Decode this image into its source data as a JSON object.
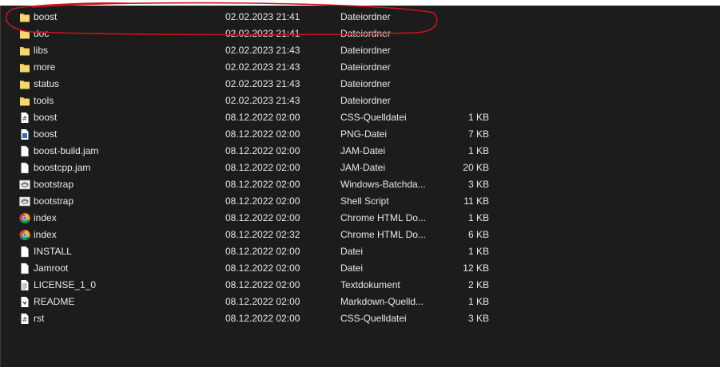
{
  "files": [
    {
      "name": "boost",
      "date": "02.02.2023 21:41",
      "type": "Dateiordner",
      "size": "",
      "icon": "folder-icon"
    },
    {
      "name": "doc",
      "date": "02.02.2023 21:41",
      "type": "Dateiordner",
      "size": "",
      "icon": "folder-icon"
    },
    {
      "name": "libs",
      "date": "02.02.2023 21:43",
      "type": "Dateiordner",
      "size": "",
      "icon": "folder-icon"
    },
    {
      "name": "more",
      "date": "02.02.2023 21:43",
      "type": "Dateiordner",
      "size": "",
      "icon": "folder-icon"
    },
    {
      "name": "status",
      "date": "02.02.2023 21:43",
      "type": "Dateiordner",
      "size": "",
      "icon": "folder-icon"
    },
    {
      "name": "tools",
      "date": "02.02.2023 21:43",
      "type": "Dateiordner",
      "size": "",
      "icon": "folder-icon"
    },
    {
      "name": "boost",
      "date": "08.12.2022 02:00",
      "type": "CSS-Quelldatei",
      "size": "1 KB",
      "icon": "css-file-icon"
    },
    {
      "name": "boost",
      "date": "08.12.2022 02:00",
      "type": "PNG-Datei",
      "size": "7 KB",
      "icon": "png-file-icon"
    },
    {
      "name": "boost-build.jam",
      "date": "08.12.2022 02:00",
      "type": "JAM-Datei",
      "size": "1 KB",
      "icon": "file-icon"
    },
    {
      "name": "boostcpp.jam",
      "date": "08.12.2022 02:00",
      "type": "JAM-Datei",
      "size": "20 KB",
      "icon": "file-icon"
    },
    {
      "name": "bootstrap",
      "date": "08.12.2022 02:00",
      "type": "Windows-Batchda...",
      "size": "3 KB",
      "icon": "batch-file-icon"
    },
    {
      "name": "bootstrap",
      "date": "08.12.2022 02:00",
      "type": "Shell Script",
      "size": "11 KB",
      "icon": "batch-file-icon"
    },
    {
      "name": "index",
      "date": "08.12.2022 02:00",
      "type": "Chrome HTML Do...",
      "size": "1 KB",
      "icon": "chrome-icon"
    },
    {
      "name": "index",
      "date": "08.12.2022 02:32",
      "type": "Chrome HTML Do...",
      "size": "6 KB",
      "icon": "chrome-icon"
    },
    {
      "name": "INSTALL",
      "date": "08.12.2022 02:00",
      "type": "Datei",
      "size": "1 KB",
      "icon": "file-icon"
    },
    {
      "name": "Jamroot",
      "date": "08.12.2022 02:00",
      "type": "Datei",
      "size": "12 KB",
      "icon": "file-icon"
    },
    {
      "name": "LICENSE_1_0",
      "date": "08.12.2022 02:00",
      "type": "Textdokument",
      "size": "2 KB",
      "icon": "text-file-icon"
    },
    {
      "name": "README",
      "date": "08.12.2022 02:00",
      "type": "Markdown-Quelld...",
      "size": "1 KB",
      "icon": "markdown-file-icon"
    },
    {
      "name": "rst",
      "date": "08.12.2022 02:00",
      "type": "CSS-Quelldatei",
      "size": "3 KB",
      "icon": "css-file-icon"
    }
  ],
  "colors": {
    "background": "#1c1c1c",
    "text": "#e8e8e8",
    "folder": "#f4c94b",
    "annotation": "#c8141e"
  }
}
